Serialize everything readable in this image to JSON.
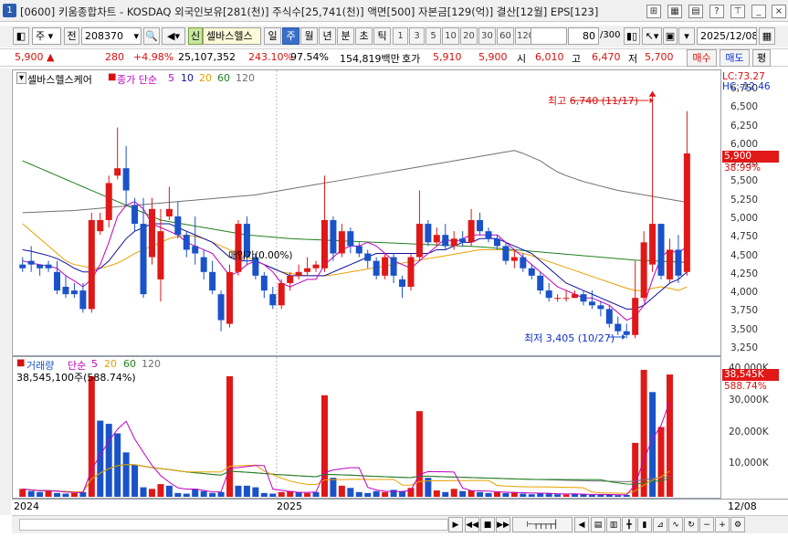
{
  "window": {
    "icon_label": "1",
    "title": "[0600] 키움종합차트 - KOSDAQ 외국인보유[281(천)] 주식수[25,741(천)] 액면[500] 자본금[129(억)] 결산[12월] EPS[123]"
  },
  "toolbar": {
    "market": "주",
    "prefix": "전",
    "code": "208370",
    "name_badge": "신",
    "stock_name": "셀바스헬스",
    "periods": [
      "일",
      "주",
      "월",
      "년",
      "분",
      "초",
      "틱"
    ],
    "active_period": "주",
    "intervals": [
      "1",
      "3",
      "5",
      "10",
      "20",
      "30",
      "60",
      "120"
    ],
    "count": "80",
    "count_total": "/300",
    "date": "2025/12/08"
  },
  "quote": {
    "price": "5,900",
    "change_arrow": "▲",
    "change": "280",
    "change_pct": "+4.98%",
    "volume": "25,107,352",
    "volume_ratio": "243.10%",
    "value_ratio": "97.54%",
    "amount": "154,819백만",
    "bid_label": "호가",
    "bid": "5,910",
    "ask": "5,900",
    "open_label": "시",
    "open": "6,010",
    "high_label": "고",
    "high": "6,470",
    "low_label": "저",
    "low": "5,700",
    "buy_button": "매수",
    "sell_button": "매도",
    "eval_button": "평"
  },
  "price_panel": {
    "legend_name": "셀바스헬스케어",
    "legend_ma_label": "종가 단순",
    "legend_ma": [
      "5",
      "10",
      "20",
      "60",
      "120"
    ],
    "lc": "LC:73.27",
    "hc": "HC:-12.46",
    "high_annotation": "최고 6,740 (11/17)",
    "low_annotation": "최저 3,405 (10/27)",
    "avg_price_label": "매입가(0.00%)",
    "current_price_tag": "5,900",
    "current_pct_tag": "38.99%"
  },
  "volume_panel": {
    "legend_name": "거래량",
    "legend_ma_label": "단순",
    "legend_ma": [
      "5",
      "20",
      "60",
      "120"
    ],
    "volume_text": "38,545,100주(588.74%)",
    "current_vol_tag": "38,545K",
    "current_pct_tag": "588.74%"
  },
  "x_labels": {
    "y2024": "2024",
    "y2025": "2025",
    "last": "12/08"
  },
  "colors": {
    "up": "#e01818",
    "down": "#1a52c8",
    "ma5": "#c000c0",
    "ma10": "#1010a0",
    "ma20": "#e8a000",
    "ma60": "#208020",
    "ma120": "#707070"
  },
  "chart_data": [
    {
      "type": "candlestick",
      "title": "셀바스헬스케어",
      "ylim": [
        3250,
        6750
      ],
      "y_ticks": [
        3250,
        3500,
        3750,
        4000,
        4250,
        4500,
        4750,
        5000,
        5250,
        5500,
        5750,
        6000,
        6250,
        6500,
        6750
      ],
      "candles": [
        {
          "o": 4400,
          "h": 4500,
          "c": 4350,
          "l": 4300
        },
        {
          "o": 4450,
          "h": 4650,
          "c": 4400,
          "l": 4300
        },
        {
          "o": 4400,
          "h": 4400,
          "c": 4350,
          "l": 4250
        },
        {
          "o": 4400,
          "h": 4450,
          "c": 4350,
          "l": 4300
        },
        {
          "o": 4300,
          "h": 4450,
          "c": 4050,
          "l": 4000
        },
        {
          "o": 4100,
          "h": 4250,
          "c": 4000,
          "l": 3950
        },
        {
          "o": 4050,
          "h": 4150,
          "c": 4000,
          "l": 3950
        },
        {
          "o": 4050,
          "h": 4150,
          "c": 3800,
          "l": 3750
        },
        {
          "o": 3800,
          "h": 5100,
          "c": 5000,
          "l": 3750
        },
        {
          "o": 4850,
          "h": 5100,
          "c": 5000,
          "l": 4800
        },
        {
          "o": 5000,
          "h": 5600,
          "c": 5500,
          "l": 4900
        },
        {
          "o": 5600,
          "h": 6250,
          "c": 5700,
          "l": 5550
        },
        {
          "o": 5700,
          "h": 6000,
          "c": 5400,
          "l": 5200
        },
        {
          "o": 5200,
          "h": 5300,
          "c": 4950,
          "l": 4850
        },
        {
          "o": 4950,
          "h": 5300,
          "c": 4000,
          "l": 3950
        },
        {
          "o": 4500,
          "h": 5300,
          "c": 5150,
          "l": 4400
        },
        {
          "o": 4200,
          "h": 5150,
          "c": 4850,
          "l": 3900
        },
        {
          "o": 5050,
          "h": 5450,
          "c": 5150,
          "l": 5000
        },
        {
          "o": 5050,
          "h": 5250,
          "c": 4800,
          "l": 4750
        },
        {
          "o": 4800,
          "h": 4850,
          "c": 4600,
          "l": 4500
        },
        {
          "o": 4650,
          "h": 5050,
          "c": 4550,
          "l": 4400
        },
        {
          "o": 4500,
          "h": 4600,
          "c": 4300,
          "l": 4200
        },
        {
          "o": 4300,
          "h": 4450,
          "c": 4050,
          "l": 4000
        },
        {
          "o": 4000,
          "h": 4050,
          "c": 3650,
          "l": 3500
        },
        {
          "o": 3600,
          "h": 4400,
          "c": 4300,
          "l": 3550
        },
        {
          "o": 4300,
          "h": 5000,
          "c": 4950,
          "l": 4250
        },
        {
          "o": 4950,
          "h": 5050,
          "c": 4500,
          "l": 4400
        },
        {
          "o": 4500,
          "h": 4550,
          "c": 4250,
          "l": 4200
        },
        {
          "o": 4250,
          "h": 4300,
          "c": 4050,
          "l": 3950
        },
        {
          "o": 4000,
          "h": 4100,
          "c": 3850,
          "l": 3800
        },
        {
          "o": 3850,
          "h": 4200,
          "c": 4150,
          "l": 3800
        },
        {
          "o": 4150,
          "h": 4300,
          "c": 4250,
          "l": 4050
        },
        {
          "o": 4250,
          "h": 4400,
          "c": 4300,
          "l": 4200
        },
        {
          "o": 4300,
          "h": 4500,
          "c": 4350,
          "l": 4250
        },
        {
          "o": 4350,
          "h": 4450,
          "c": 4400,
          "l": 4300
        },
        {
          "o": 4350,
          "h": 5600,
          "c": 5000,
          "l": 4300
        },
        {
          "o": 5000,
          "h": 5050,
          "c": 4550,
          "l": 4450
        },
        {
          "o": 4550,
          "h": 4950,
          "c": 4850,
          "l": 4500
        },
        {
          "o": 4850,
          "h": 4900,
          "c": 4650,
          "l": 4550
        },
        {
          "o": 4650,
          "h": 4700,
          "c": 4550,
          "l": 4500
        },
        {
          "o": 4550,
          "h": 4600,
          "c": 4450,
          "l": 4350
        },
        {
          "o": 4450,
          "h": 4500,
          "c": 4250,
          "l": 4200
        },
        {
          "o": 4250,
          "h": 4550,
          "c": 4500,
          "l": 4200
        },
        {
          "o": 4500,
          "h": 4550,
          "c": 4250,
          "l": 4150
        },
        {
          "o": 4200,
          "h": 4250,
          "c": 4100,
          "l": 3950
        },
        {
          "o": 4100,
          "h": 4550,
          "c": 4500,
          "l": 4050
        },
        {
          "o": 4500,
          "h": 5400,
          "c": 4950,
          "l": 4450
        },
        {
          "o": 4950,
          "h": 5000,
          "c": 4700,
          "l": 4650
        },
        {
          "o": 4700,
          "h": 4900,
          "c": 4800,
          "l": 4650
        },
        {
          "o": 4800,
          "h": 4950,
          "c": 4650,
          "l": 4600
        },
        {
          "o": 4650,
          "h": 4850,
          "c": 4750,
          "l": 4600
        },
        {
          "o": 4750,
          "h": 4850,
          "c": 4700,
          "l": 4650
        },
        {
          "o": 4700,
          "h": 5150,
          "c": 5000,
          "l": 4650
        },
        {
          "o": 5000,
          "h": 5100,
          "c": 4850,
          "l": 4800
        },
        {
          "o": 4850,
          "h": 4900,
          "c": 4750,
          "l": 4700
        },
        {
          "o": 4750,
          "h": 4800,
          "c": 4650,
          "l": 4600
        },
        {
          "o": 4650,
          "h": 4700,
          "c": 4450,
          "l": 4400
        },
        {
          "o": 4450,
          "h": 4600,
          "c": 4500,
          "l": 4350
        },
        {
          "o": 4500,
          "h": 4550,
          "c": 4350,
          "l": 4300
        },
        {
          "o": 4350,
          "h": 4400,
          "c": 4250,
          "l": 4200
        },
        {
          "o": 4250,
          "h": 4300,
          "c": 4050,
          "l": 4000
        },
        {
          "o": 4050,
          "h": 4150,
          "c": 3950,
          "l": 3900
        },
        {
          "o": 3950,
          "h": 4000,
          "c": 3950,
          "l": 3900
        },
        {
          "o": 3950,
          "h": 4050,
          "c": 3950,
          "l": 3900
        },
        {
          "o": 3950,
          "h": 4050,
          "c": 4000,
          "l": 3950
        },
        {
          "o": 4000,
          "h": 4050,
          "c": 3900,
          "l": 3850
        },
        {
          "o": 3900,
          "h": 4050,
          "c": 3850,
          "l": 3800
        },
        {
          "o": 3850,
          "h": 3900,
          "c": 3800,
          "l": 3700
        },
        {
          "o": 3800,
          "h": 3850,
          "c": 3600,
          "l": 3550
        },
        {
          "o": 3600,
          "h": 3700,
          "c": 3500,
          "l": 3450
        },
        {
          "o": 3500,
          "h": 3600,
          "c": 3450,
          "l": 3405
        },
        {
          "o": 3450,
          "h": 4450,
          "c": 3950,
          "l": 3405
        },
        {
          "o": 3950,
          "h": 4850,
          "c": 4700,
          "l": 3900
        },
        {
          "o": 4400,
          "h": 6740,
          "c": 4950,
          "l": 4300
        },
        {
          "o": 4950,
          "h": 4700,
          "c": 4250,
          "l": 4200
        },
        {
          "o": 4200,
          "h": 4750,
          "c": 4600,
          "l": 4150
        },
        {
          "o": 4600,
          "h": 4800,
          "c": 4250,
          "l": 4150
        },
        {
          "o": 4300,
          "h": 6470,
          "c": 5900,
          "l": 4250
        }
      ],
      "ma5": [
        4450,
        4420,
        4400,
        4380,
        4350,
        4250,
        4180,
        4100,
        4200,
        4400,
        4700,
        5050,
        5200,
        5250,
        5150,
        4950,
        4900,
        4850,
        4800,
        4700,
        4650,
        4600,
        4550,
        4400,
        4250,
        4300,
        4400,
        4450,
        4400,
        4300,
        4150,
        4100,
        4150,
        4200,
        4200,
        4400,
        4500,
        4600,
        4650,
        4650,
        4700,
        4650,
        4550,
        4450,
        4400,
        4350,
        4450,
        4550,
        4650,
        4750,
        4700,
        4750,
        4800,
        4800,
        4800,
        4800,
        4700,
        4600,
        4500,
        4400,
        4300,
        4200,
        4100,
        4050,
        4000,
        3950,
        3950,
        3900,
        3850,
        3750,
        3650,
        3700,
        3850,
        4200,
        4500,
        4600,
        4550,
        4650
      ],
      "ma10": [
        4600,
        4580,
        4550,
        4520,
        4480,
        4420,
        4350,
        4300,
        4300,
        4350,
        4450,
        4600,
        4750,
        4850,
        4900,
        4950,
        4950,
        4950,
        4900,
        4850,
        4800,
        4750,
        4700,
        4600,
        4500,
        4450,
        4450,
        4450,
        4400,
        4350,
        4300,
        4250,
        4250,
        4250,
        4250,
        4250,
        4300,
        4350,
        4400,
        4450,
        4500,
        4550,
        4550,
        4550,
        4550,
        4550,
        4550,
        4550,
        4600,
        4600,
        4650,
        4700,
        4700,
        4750,
        4750,
        4750,
        4700,
        4650,
        4600,
        4550,
        4450,
        4350,
        4250,
        4150,
        4100,
        4050,
        4000,
        3950,
        3900,
        3850,
        3800,
        3800,
        3850,
        3950,
        4050,
        4150,
        4200,
        4300
      ],
      "ma20": [
        4950,
        4850,
        4750,
        4650,
        4550,
        4450,
        4400,
        4380,
        4350,
        4350,
        4380,
        4420,
        4480,
        4550,
        4600,
        4650,
        4700,
        4750,
        4780,
        4800,
        4780,
        4750,
        4700,
        4650,
        4600,
        4550,
        4500,
        4450,
        4400,
        4350,
        4300,
        4280,
        4260,
        4250,
        4250,
        4250,
        4260,
        4280,
        4300,
        4320,
        4340,
        4360,
        4380,
        4400,
        4420,
        4440,
        4460,
        4480,
        4500,
        4520,
        4540,
        4560,
        4580,
        4600,
        4600,
        4600,
        4600,
        4580,
        4550,
        4520,
        4480,
        4440,
        4400,
        4360,
        4320,
        4280,
        4240,
        4200,
        4160,
        4120,
        4080,
        4050,
        4050,
        4080,
        4100,
        4080,
        4050,
        4100
      ],
      "ma60": [
        5800,
        5750,
        5700,
        5650,
        5600,
        5550,
        5500,
        5450,
        5400,
        5350,
        5300,
        5250,
        5200,
        5150,
        5100,
        5050,
        5000,
        4980,
        4960,
        4940,
        4920,
        4900,
        4880,
        4860,
        4840,
        4820,
        4800,
        4790,
        4780,
        4770,
        4760,
        4750,
        4745,
        4740,
        4735,
        4730,
        4725,
        4720,
        4715,
        4710,
        4705,
        4700,
        4695,
        4690,
        4685,
        4680,
        4675,
        4670,
        4665,
        4660,
        4655,
        4650,
        4645,
        4640,
        4630,
        4620,
        4610,
        4600,
        4590,
        4580,
        4570,
        4560,
        4550,
        4540,
        4530,
        4520,
        4510,
        4500,
        4490,
        4480,
        4470,
        4460,
        4455,
        4450,
        4445,
        4440,
        4435,
        4430
      ],
      "ma120": [
        5100,
        5105,
        5110,
        5115,
        5120,
        5125,
        5130,
        5140,
        5150,
        5160,
        5170,
        5180,
        5190,
        5200,
        5210,
        5220,
        5230,
        5240,
        5250,
        5260,
        5270,
        5280,
        5290,
        5300,
        5310,
        5320,
        5330,
        5340,
        5360,
        5380,
        5400,
        5420,
        5440,
        5460,
        5480,
        5500,
        5520,
        5540,
        5560,
        5580,
        5600,
        5620,
        5640,
        5660,
        5680,
        5700,
        5720,
        5740,
        5760,
        5780,
        5800,
        5820,
        5840,
        5860,
        5880,
        5900,
        5920,
        5940,
        5900,
        5850,
        5800,
        5720,
        5650,
        5600,
        5560,
        5520,
        5490,
        5460,
        5430,
        5400,
        5380,
        5360,
        5340,
        5320,
        5300,
        5280,
        5260,
        5240
      ]
    },
    {
      "type": "bar",
      "title": "거래량",
      "ylim": [
        0,
        40000
      ],
      "y_ticks": [
        10000,
        20000,
        30000,
        40000
      ],
      "unit": "K",
      "volumes": [
        2500,
        1800,
        1500,
        2000,
        1200,
        1000,
        1200,
        1500,
        38000,
        24000,
        23000,
        20000,
        14000,
        10000,
        3000,
        2500,
        4000,
        3500,
        1200,
        1000,
        2500,
        1800,
        1200,
        1500,
        38000,
        3500,
        3500,
        3000,
        1200,
        1000,
        1500,
        1800,
        1500,
        1200,
        1500,
        32000,
        6000,
        3500,
        2800,
        1500,
        1200,
        1800,
        1500,
        2200,
        1800,
        2800,
        27000,
        6000,
        2000,
        1500,
        2500,
        1800,
        2000,
        1500,
        1200,
        1500,
        1200,
        1500,
        1000,
        800,
        1200,
        1000,
        800,
        700,
        900,
        800,
        600,
        700,
        600,
        500,
        600,
        17000,
        40000,
        33000,
        22000,
        38545
      ],
      "up": [
        true,
        false,
        false,
        true,
        false,
        false,
        true,
        false,
        true,
        false,
        false,
        false,
        false,
        false,
        false,
        true,
        true,
        false,
        false,
        false,
        false,
        false,
        false,
        false,
        true,
        false,
        false,
        false,
        false,
        false,
        true,
        true,
        false,
        true,
        false,
        true,
        false,
        true,
        false,
        false,
        false,
        false,
        true,
        false,
        false,
        true,
        true,
        false,
        true,
        false,
        true,
        false,
        true,
        false,
        false,
        true,
        false,
        true,
        false,
        false,
        false,
        false,
        false,
        true,
        false,
        false,
        false,
        false,
        false,
        false,
        false,
        true,
        true,
        false,
        true,
        true
      ]
    }
  ]
}
